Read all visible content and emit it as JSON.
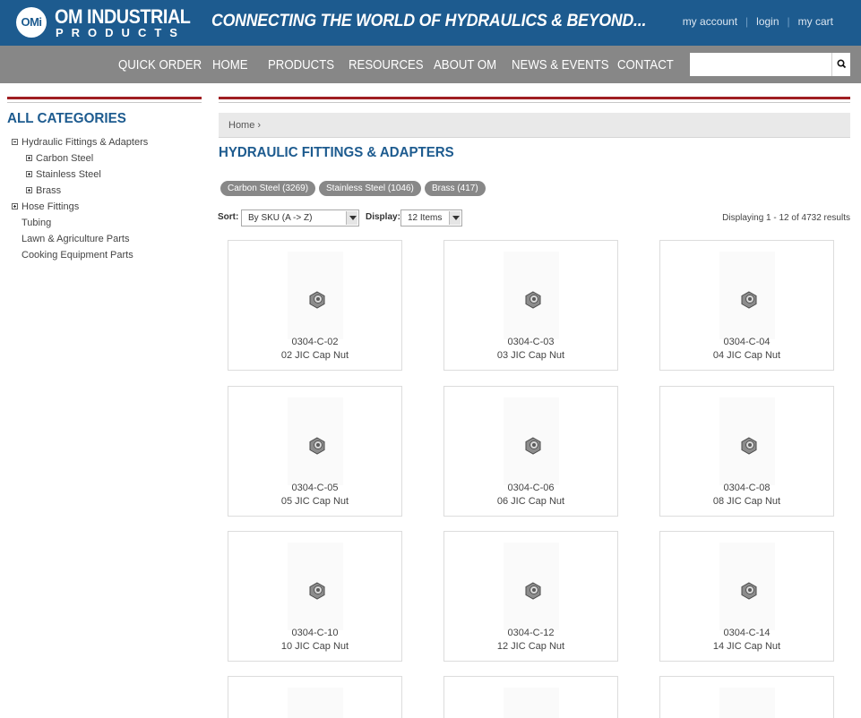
{
  "header": {
    "logo_badge": "OMi",
    "logo_line1": "OM INDUSTRIAL",
    "logo_line2": "PRODUCTS",
    "tagline": "CONNECTING THE WORLD OF HYDRAULICS & BEYOND...",
    "links": {
      "my_account": "my account",
      "login": "login",
      "my_cart": "my cart"
    },
    "colors": {
      "brand_blue": "#1d5b8f",
      "nav_gray": "#878787",
      "accent_red": "#a01f23"
    }
  },
  "nav": {
    "items": [
      "QUICK ORDER",
      "HOME",
      "PRODUCTS",
      "RESOURCES",
      "ABOUT OM",
      "NEWS & EVENTS",
      "CONTACT"
    ],
    "search": {
      "placeholder": "",
      "value": "",
      "button_icon": "search-icon"
    }
  },
  "sidebar": {
    "heading": "ALL CATEGORIES",
    "tree": [
      {
        "label": "Hydraulic Fittings & Adapters",
        "toggle": "minus",
        "level": 0
      },
      {
        "label": "Carbon Steel",
        "toggle": "plus",
        "level": 1
      },
      {
        "label": "Stainless Steel",
        "toggle": "plus",
        "level": 1
      },
      {
        "label": "Brass",
        "toggle": "plus",
        "level": 1
      },
      {
        "label": "Hose Fittings",
        "toggle": "plus",
        "level": 0
      },
      {
        "label": "Tubing",
        "toggle": "none",
        "level": 0
      },
      {
        "label": "Lawn & Agriculture Parts",
        "toggle": "none",
        "level": 0
      },
      {
        "label": "Cooking Equipment Parts",
        "toggle": "none",
        "level": 0
      }
    ]
  },
  "main": {
    "breadcrumb": "Home ›",
    "title": "HYDRAULIC FITTINGS & ADAPTERS",
    "filters": [
      "Carbon Steel (3269)",
      "Stainless Steel (1046)",
      "Brass (417)"
    ],
    "sort_label": "Sort:",
    "sort_value": "By SKU (A -> Z)",
    "display_label": "Display:",
    "display_value": "12 Items",
    "results": "Displaying 1 - 12 of 4732 results",
    "products": [
      {
        "sku": "0304-C-02",
        "name": "02 JIC Cap Nut"
      },
      {
        "sku": "0304-C-03",
        "name": "03 JIC Cap Nut"
      },
      {
        "sku": "0304-C-04",
        "name": "04 JIC Cap Nut"
      },
      {
        "sku": "0304-C-05",
        "name": "05 JIC Cap Nut"
      },
      {
        "sku": "0304-C-06",
        "name": "06 JIC Cap Nut"
      },
      {
        "sku": "0304-C-08",
        "name": "08 JIC Cap Nut"
      },
      {
        "sku": "0304-C-10",
        "name": "10 JIC Cap Nut"
      },
      {
        "sku": "0304-C-12",
        "name": "12 JIC Cap Nut"
      },
      {
        "sku": "0304-C-14",
        "name": "14 JIC Cap Nut"
      },
      {
        "sku": "",
        "name": ""
      },
      {
        "sku": "",
        "name": ""
      },
      {
        "sku": "",
        "name": ""
      }
    ]
  }
}
